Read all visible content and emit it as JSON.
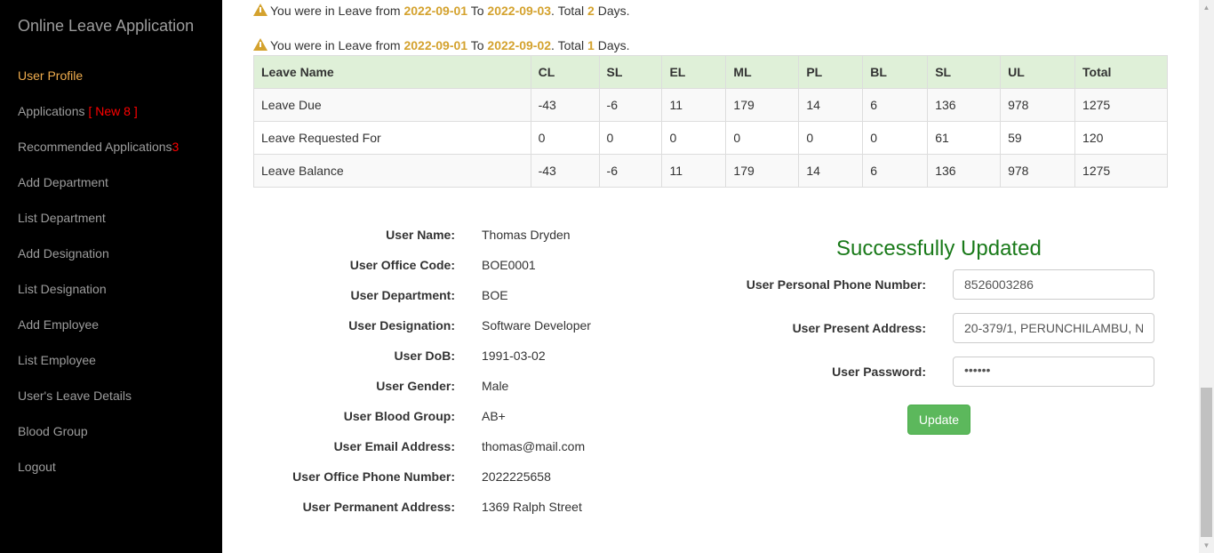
{
  "sidebar": {
    "brand": "Online Leave Application",
    "items": [
      {
        "label": "User Profile"
      },
      {
        "label": "Applications",
        "badge": "[ New 8 ]"
      },
      {
        "label": "Recommended Applications",
        "badge": "3"
      },
      {
        "label": "Add Department"
      },
      {
        "label": "List Department"
      },
      {
        "label": "Add Designation"
      },
      {
        "label": "List Designation"
      },
      {
        "label": "Add Employee"
      },
      {
        "label": "List Employee"
      },
      {
        "label": "User's Leave Details"
      },
      {
        "label": "Blood Group"
      },
      {
        "label": "Logout"
      }
    ]
  },
  "alerts": [
    {
      "prefix": "You were in Leave from",
      "from": "2022-09-01",
      "to_word": "To",
      "to": "2022-09-03",
      "total_word": ". Total",
      "days": "2",
      "suffix": "Days."
    },
    {
      "prefix": "You were in Leave from",
      "from": "2022-09-01",
      "to_word": "To",
      "to": "2022-09-02",
      "total_word": ". Total",
      "days": "1",
      "suffix": "Days."
    }
  ],
  "leave_table": {
    "headers": [
      "Leave Name",
      "CL",
      "SL",
      "EL",
      "ML",
      "PL",
      "BL",
      "SL",
      "UL",
      "Total"
    ],
    "rows": [
      [
        "Leave Due",
        "-43",
        "-6",
        "11",
        "179",
        "14",
        "6",
        "136",
        "978",
        "1275"
      ],
      [
        "Leave Requested For",
        "0",
        "0",
        "0",
        "0",
        "0",
        "0",
        "61",
        "59",
        "120"
      ],
      [
        "Leave Balance",
        "-43",
        "-6",
        "11",
        "179",
        "14",
        "6",
        "136",
        "978",
        "1275"
      ]
    ]
  },
  "profile": [
    {
      "label": "User Name:",
      "value": "Thomas Dryden"
    },
    {
      "label": "User Office Code:",
      "value": "BOE0001"
    },
    {
      "label": "User Department:",
      "value": "BOE"
    },
    {
      "label": "User Designation:",
      "value": "Software Developer"
    },
    {
      "label": "User DoB:",
      "value": "1991-03-02"
    },
    {
      "label": "User Gender:",
      "value": "Male"
    },
    {
      "label": "User Blood Group:",
      "value": "AB+"
    },
    {
      "label": "User Email Address:",
      "value": "thomas@mail.com"
    },
    {
      "label": "User Office Phone Number:",
      "value": "2022225658"
    },
    {
      "label": "User Permanent Address:",
      "value": "1369 Ralph Street"
    }
  ],
  "form": {
    "success_message": "Successfully Updated",
    "phone_label": "User Personal Phone Number:",
    "phone_value": "8526003286",
    "address_label": "User Present Address:",
    "address_value": "20-379/1, PERUNCHILAMBU, N",
    "password_label": "User Password:",
    "password_value": "••••••",
    "update_label": "Update"
  },
  "colors": {
    "sidebar_bg": "#000000",
    "nav_text": "#9d9d9d",
    "nav_active": "#f0ad4e",
    "badge": "#ff0000",
    "highlight": "#d4a22e",
    "table_header_bg": "#dff0d8",
    "success": "#1a7a1a",
    "button": "#5cb85c"
  }
}
